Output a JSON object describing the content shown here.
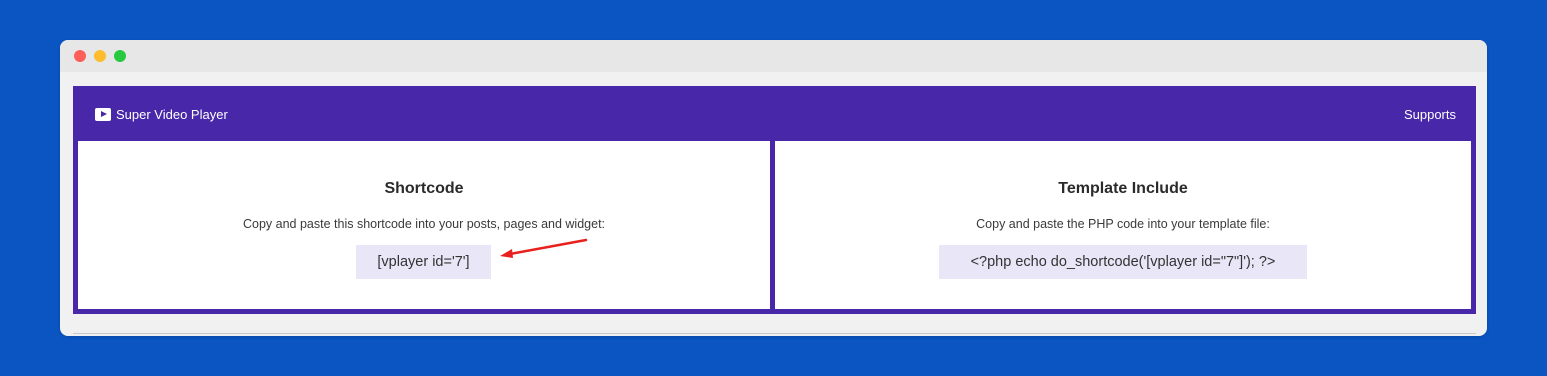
{
  "header": {
    "brand": "Super Video Player",
    "supports": "Supports"
  },
  "shortcode": {
    "title": "Shortcode",
    "description": "Copy and paste this shortcode into your posts, pages and widget:",
    "code": "[vplayer id='7']"
  },
  "template_include": {
    "title": "Template Include",
    "description": "Copy and paste the PHP code into your template file:",
    "code": "<?php echo do_shortcode('[vplayer id=\"7\"]'); ?>"
  },
  "colors": {
    "background": "#0a55c2",
    "header": "#4827a8",
    "code_bg": "#e8e6f7",
    "arrow": "#e8201e"
  },
  "icons": {
    "brand": "play-icon",
    "annotation": "red-arrow-icon"
  }
}
